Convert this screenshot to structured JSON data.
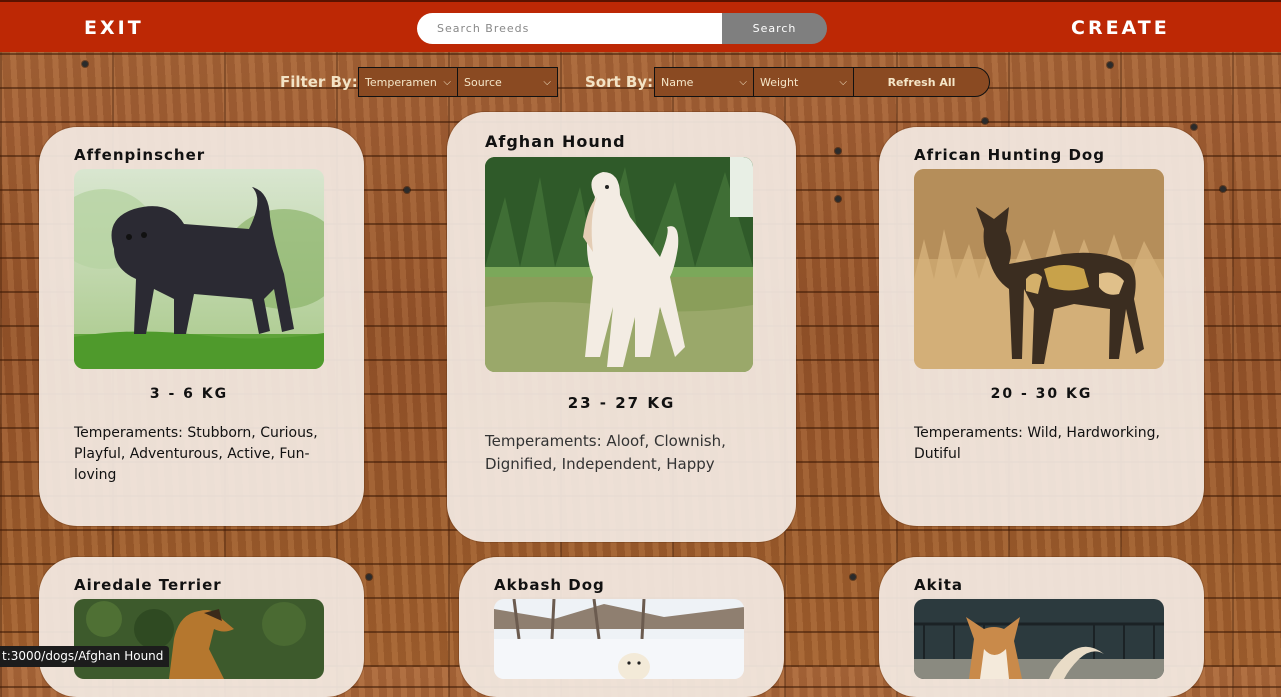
{
  "header": {
    "exit_label": "EXIT",
    "create_label": "CREATE",
    "search_placeholder": "Search Breeds",
    "search_button": "Search"
  },
  "filters": {
    "filter_label": "Filter By:",
    "temperament_value": "Temperamen",
    "source_value": "Source",
    "sort_label": "Sort By:",
    "name_value": "Name",
    "weight_value": "Weight",
    "refresh_label": "Refresh All"
  },
  "cards": [
    {
      "name": "Affenpinscher",
      "weight": "3 - 6 KG",
      "temperaments": "Temperaments: Stubborn, Curious, Playful, Adventurous, Active, Fun-loving"
    },
    {
      "name": "Afghan Hound",
      "weight": "23 - 27 KG",
      "temperaments": "Temperaments: Aloof, Clownish, Dignified, Independent, Happy"
    },
    {
      "name": "African Hunting Dog",
      "weight": "20 - 30 KG",
      "temperaments": "Temperaments: Wild, Hardworking, Dutiful"
    },
    {
      "name": "Airedale Terrier"
    },
    {
      "name": "Akbash Dog"
    },
    {
      "name": "Akita"
    }
  ],
  "status_bar": {
    "url": "t:3000/dogs/Afghan Hound"
  },
  "colors": {
    "header_bg": "#bd2805",
    "card_bg": "#f3eae2",
    "wood": "#9a5a2c"
  }
}
